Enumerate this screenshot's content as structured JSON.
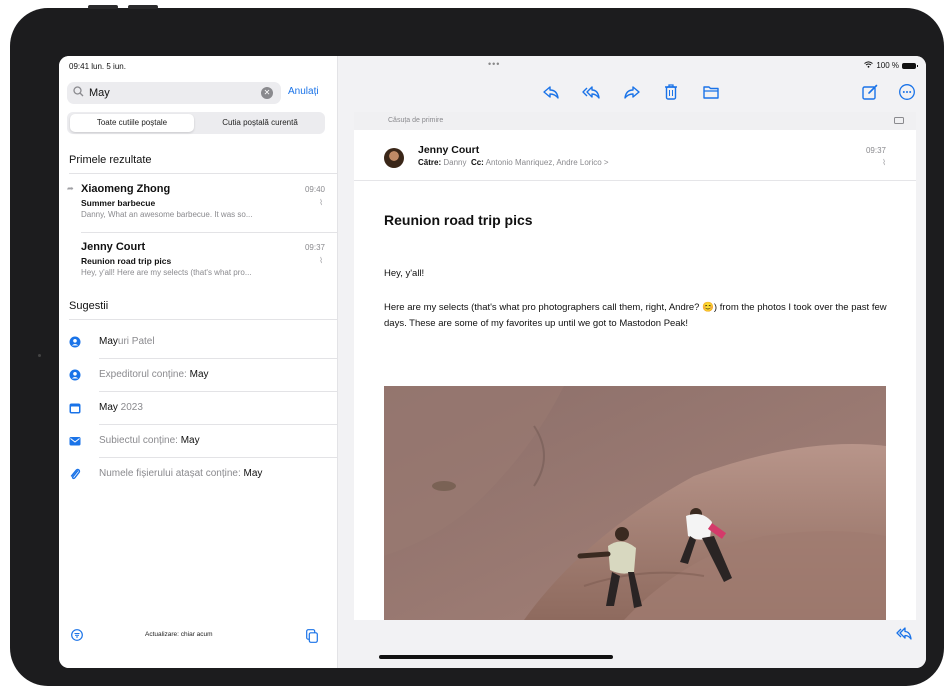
{
  "status_bar": {
    "time": "09:41 lun. 5 iun.",
    "dots": "•••",
    "battery": "100 %"
  },
  "sidebar": {
    "search": {
      "value": "May",
      "cancel_label": "Anulați"
    },
    "scope": {
      "all_mailboxes": "Toate cutiile poștale",
      "current_mailbox": "Cutia poștală curentă"
    },
    "top_hits_title": "Primele rezultate",
    "results": [
      {
        "sender": "Xiaomeng Zhong",
        "time": "09:40",
        "subject": "Summer barbecue",
        "preview": "Danny, What an awesome barbecue. It was so..."
      },
      {
        "sender": "Jenny Court",
        "time": "09:37",
        "subject": "Reunion road trip pics",
        "preview": "Hey, y'all! Here are my selects (that's what pro..."
      }
    ],
    "suggestions_title": "Sugestii",
    "suggestions": [
      {
        "icon": "person-icon",
        "bold": "May",
        "rest": "uri Patel"
      },
      {
        "icon": "person-icon",
        "light": "Expeditorul conține: ",
        "bold_end": "May"
      },
      {
        "icon": "calendar-icon",
        "bold": "May",
        "rest": " 2023"
      },
      {
        "icon": "envelope-icon",
        "light": "Subiectul conține: ",
        "bold_end": "May"
      },
      {
        "icon": "paperclip-icon",
        "light": "Numele fișierului atașat conține: ",
        "bold_end": "May"
      }
    ],
    "update_status": "Actualizare: chiar acum"
  },
  "message": {
    "mailbox": "Căsuța de primire",
    "sender": "Jenny Court",
    "to_label": "Către:",
    "to": "Danny",
    "cc_label": "Cc:",
    "cc": "Antonio Manriquez, Andre Lorico >",
    "time": "09:37",
    "subject": "Reunion road trip pics",
    "greeting": "Hey, y'all!",
    "body": "Here are my selects (that's what pro photographers call them, right, Andre? 😊) from the photos I took over the past few days. These are some of my favorites up until we got to Mastodon Peak!"
  },
  "colors": {
    "accent": "#1a73e8",
    "secondary_text": "#8a8a8e",
    "background": "#f2f2f4"
  }
}
